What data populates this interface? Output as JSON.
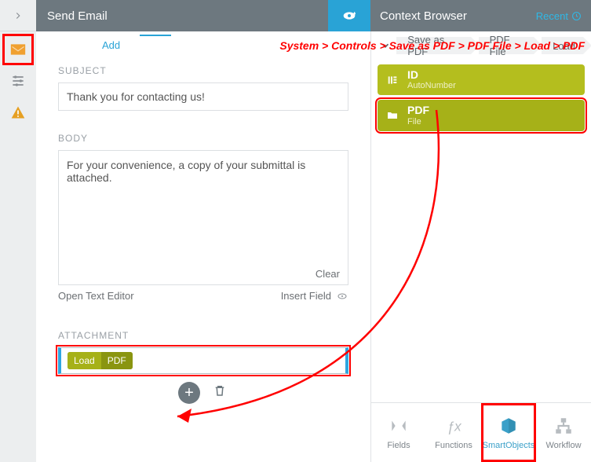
{
  "header": {
    "left_title": "Send Email",
    "right_title": "Context Browser",
    "recent_label": "Recent"
  },
  "form": {
    "add_link": "Add",
    "subject_label": "SUBJECT",
    "subject_value": "Thank you for contacting us!",
    "body_label": "BODY",
    "body_value": "For your convenience, a copy of your submittal is attached.",
    "clear_label": "Clear",
    "open_editor": "Open Text Editor",
    "insert_field": "Insert Field",
    "attachment_label": "ATTACHMENT",
    "attachment_pill": {
      "load": "Load",
      "pdf": "PDF"
    }
  },
  "context": {
    "breadcrumbs": [
      "Save as PDF",
      "PDF File",
      "Load"
    ],
    "annotation_path": "System > Controls > Save as PDF > PDF File > Load > PDF",
    "cards": [
      {
        "title": "ID",
        "subtitle": "AutoNumber"
      },
      {
        "title": "PDF",
        "subtitle": "File"
      }
    ],
    "tabs": {
      "fields": "Fields",
      "functions": "Functions",
      "smartobjects": "SmartObjects",
      "workflow": "Workflow"
    }
  }
}
